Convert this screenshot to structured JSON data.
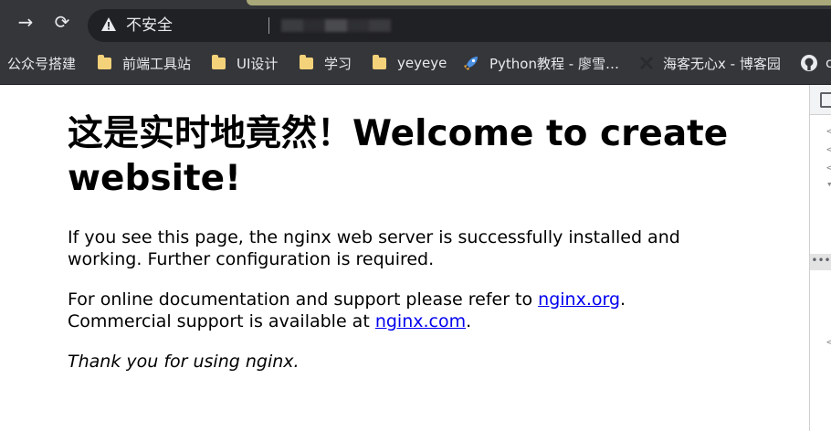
{
  "browser": {
    "security_label": "不安全",
    "bookmarks": [
      {
        "label": "公众号搭建",
        "icon": "none"
      },
      {
        "label": "前端工具站",
        "icon": "folder-icon"
      },
      {
        "label": "UI设计",
        "icon": "folder-icon"
      },
      {
        "label": "学习",
        "icon": "folder-icon"
      },
      {
        "label": "yeyeye",
        "icon": "folder-icon"
      },
      {
        "label": "Python教程 - 廖雪…",
        "icon": "rocket-icon"
      },
      {
        "label": "海客无心x - 博客园",
        "icon": "blog-icon"
      },
      {
        "label": "c",
        "icon": "github-icon"
      }
    ]
  },
  "page": {
    "heading": "这是实时地竟然！Welcome to create website!",
    "para1": "If you see this page, the nginx web server is successfully installed and working. Further configuration is required.",
    "para2_prefix": "For online documentation and support please refer to ",
    "link1": "nginx.org",
    "para2_mid": ".",
    "para2_line2": "Commercial support is available at ",
    "link2": "nginx.com",
    "para2_end": ".",
    "thanks": "Thank you for using nginx."
  },
  "colors": {
    "toolbar": "#35363a",
    "omnibox": "#202124",
    "folder": "#f3d27a",
    "link": "#0000ee"
  }
}
